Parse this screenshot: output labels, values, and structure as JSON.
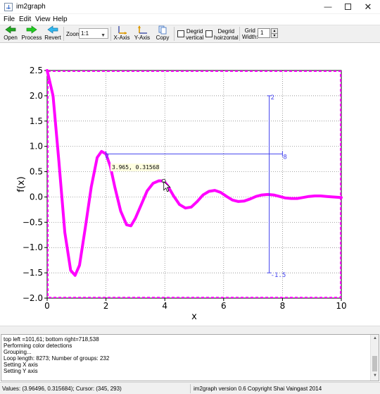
{
  "window": {
    "title": "im2graph",
    "minimize_icon": "minimize-icon",
    "maximize_icon": "maximize-icon",
    "close_icon": "close-icon"
  },
  "menu": {
    "items": [
      {
        "label": "File"
      },
      {
        "label": "Edit"
      },
      {
        "label": "View"
      },
      {
        "label": "Help"
      }
    ]
  },
  "toolbar": {
    "open_label": "Open",
    "process_label": "Process",
    "revert_label": "Revert",
    "zoom_label": "Zoom",
    "zoom_value": "1:1",
    "xaxis_label": "X-Axis",
    "yaxis_label": "Y-Axis",
    "copy_label": "Copy",
    "degrid_vertical_label_1": "Degrid",
    "degrid_vertical_label_2": "vertical",
    "degrid_horizontal_label_1": "Degrid",
    "degrid_horizontal_label_2": "hoirzontal",
    "grid_width_label_1": "Grid",
    "grid_width_label_2": "Width:",
    "grid_width_value": "1"
  },
  "colors": {
    "curve": "#ff00ff",
    "axis_markers": "#4444ee",
    "frame": "#ff00ff"
  },
  "chart_data": {
    "type": "line",
    "xlabel": "x",
    "ylabel": "f(x)",
    "xlim": [
      0,
      10
    ],
    "ylim": [
      -2.0,
      2.5
    ],
    "xticks": [
      "0",
      "2",
      "4",
      "6",
      "8",
      "10"
    ],
    "yticks": [
      "−2.0",
      "−1.5",
      "−1.0",
      "−0.5",
      "0.0",
      "0.5",
      "1.0",
      "1.5",
      "2.0",
      "2.5"
    ],
    "grid": true,
    "series": [
      {
        "x": [
          0,
          0.2,
          0.4,
          0.6,
          0.8,
          0.95,
          1.1,
          1.3,
          1.5,
          1.7,
          1.85,
          2.0,
          2.15,
          2.3,
          2.5,
          2.7,
          2.85,
          3.0,
          3.2,
          3.4,
          3.6,
          3.8,
          3.965,
          4.1,
          4.3,
          4.5,
          4.7,
          4.9,
          5.1,
          5.3,
          5.5,
          5.7,
          5.9,
          6.1,
          6.3,
          6.5,
          6.7,
          6.9,
          7.1,
          7.3,
          7.5,
          7.7,
          7.9,
          8.1,
          8.3,
          8.5,
          8.7,
          8.9,
          9.1,
          9.3,
          9.5,
          9.7,
          10.0
        ],
        "y": [
          2.5,
          2.0,
          0.7,
          -0.7,
          -1.45,
          -1.55,
          -1.35,
          -0.6,
          0.2,
          0.78,
          0.9,
          0.85,
          0.6,
          0.2,
          -0.28,
          -0.55,
          -0.57,
          -0.42,
          -0.15,
          0.12,
          0.27,
          0.32,
          0.3157,
          0.22,
          0.02,
          -0.15,
          -0.22,
          -0.2,
          -0.09,
          0.04,
          0.11,
          0.13,
          0.09,
          0.01,
          -0.06,
          -0.09,
          -0.08,
          -0.04,
          0.01,
          0.04,
          0.05,
          0.04,
          0.01,
          -0.02,
          -0.03,
          -0.03,
          -0.01,
          0.01,
          0.02,
          0.02,
          0.01,
          0.0,
          -0.01
        ]
      }
    ],
    "tooltip": "3.965, 0.31568",
    "x_axis_marker": {
      "start_label": "2",
      "end_label": "8"
    },
    "y_axis_marker": {
      "top_label": "2",
      "bottom_label": "-1.5"
    }
  },
  "log": {
    "lines": [
      "top left =101,61; bottom right=718,538",
      "Performing color detections",
      "Grouping...",
      "Loop length: 8273; Number of groups: 232",
      "Setting X axis",
      "Setting Y axis"
    ]
  },
  "status": {
    "values": "Values: (3.96496, 0.315684); Cursor: (345, 293)",
    "version": "im2graph version 0.6 Copyright Shai Vaingast 2014"
  }
}
